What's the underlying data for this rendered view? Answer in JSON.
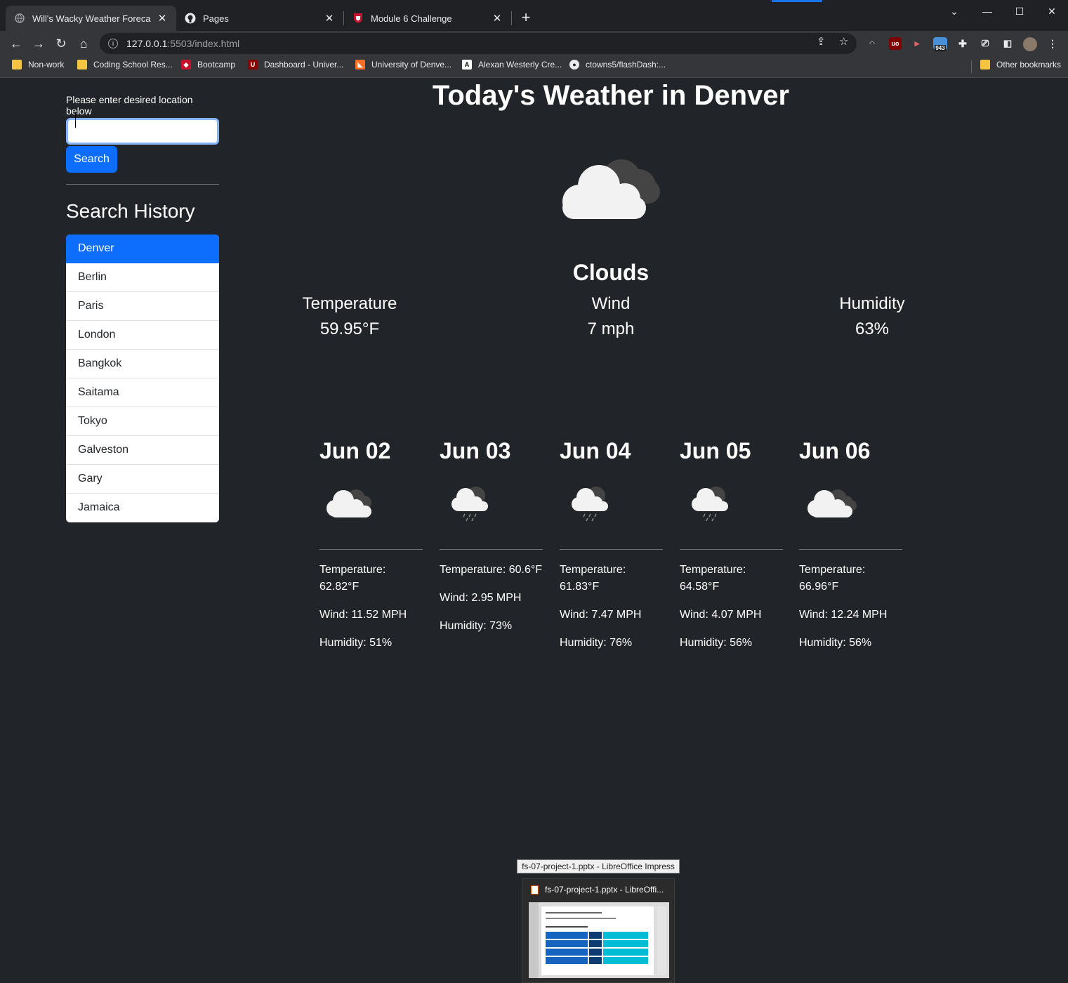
{
  "browser": {
    "tabs": [
      {
        "title": "Will's Wacky Weather Forecast",
        "active": true
      },
      {
        "title": "Pages",
        "active": false
      },
      {
        "title": "Module 6 Challenge",
        "active": false
      }
    ],
    "url_host": "127.0.0.1",
    "url_path": ":5503/index.html",
    "extension_badge": "943",
    "bookmarks": [
      "Non-work",
      "Coding School Res...",
      "Bootcamp",
      "Dashboard - Univer...",
      "University of Denve...",
      "Alexan Westerly Cre...",
      "ctowns5/flashDash:..."
    ],
    "other_bookmarks": "Other bookmarks"
  },
  "sidebar": {
    "location_label": "Please enter desired location below",
    "search_value": "",
    "search_button": "Search",
    "history_title": "Search History",
    "history": [
      "Denver",
      "Berlin",
      "Paris",
      "London",
      "Bangkok",
      "Saitama",
      "Tokyo",
      "Galveston",
      "Gary",
      "Jamaica"
    ]
  },
  "today": {
    "title": "Today's Weather in Denver",
    "icon": "clouds-icon",
    "condition": "Clouds",
    "temperature_label": "Temperature",
    "temperature": "59.95°F",
    "wind_label": "Wind",
    "wind": "7 mph",
    "humidity_label": "Humidity",
    "humidity": "63%"
  },
  "forecast": [
    {
      "date": "Jun 02",
      "icon": "clouds-icon",
      "temp": "Temperature: 62.82°F",
      "wind": "Wind: 11.52 MPH",
      "humidity": "Humidity: 51%"
    },
    {
      "date": "Jun 03",
      "icon": "rain-icon",
      "temp": "Temperature: 60.6°F",
      "wind": "Wind: 2.95 MPH",
      "humidity": "Humidity: 73%"
    },
    {
      "date": "Jun 04",
      "icon": "rain-icon",
      "temp": "Temperature: 61.83°F",
      "wind": "Wind: 7.47 MPH",
      "humidity": "Humidity: 76%"
    },
    {
      "date": "Jun 05",
      "icon": "rain-icon",
      "temp": "Temperature: 64.58°F",
      "wind": "Wind: 4.07 MPH",
      "humidity": "Humidity: 56%"
    },
    {
      "date": "Jun 06",
      "icon": "clouds-icon",
      "temp": "Temperature: 66.96°F",
      "wind": "Wind: 12.24 MPH",
      "humidity": "Humidity: 56%"
    }
  ],
  "taskbar": {
    "tooltip": "fs-07-project-1.pptx - LibreOffice Impress",
    "preview_title": "fs-07-project-1.pptx - LibreOffi..."
  }
}
